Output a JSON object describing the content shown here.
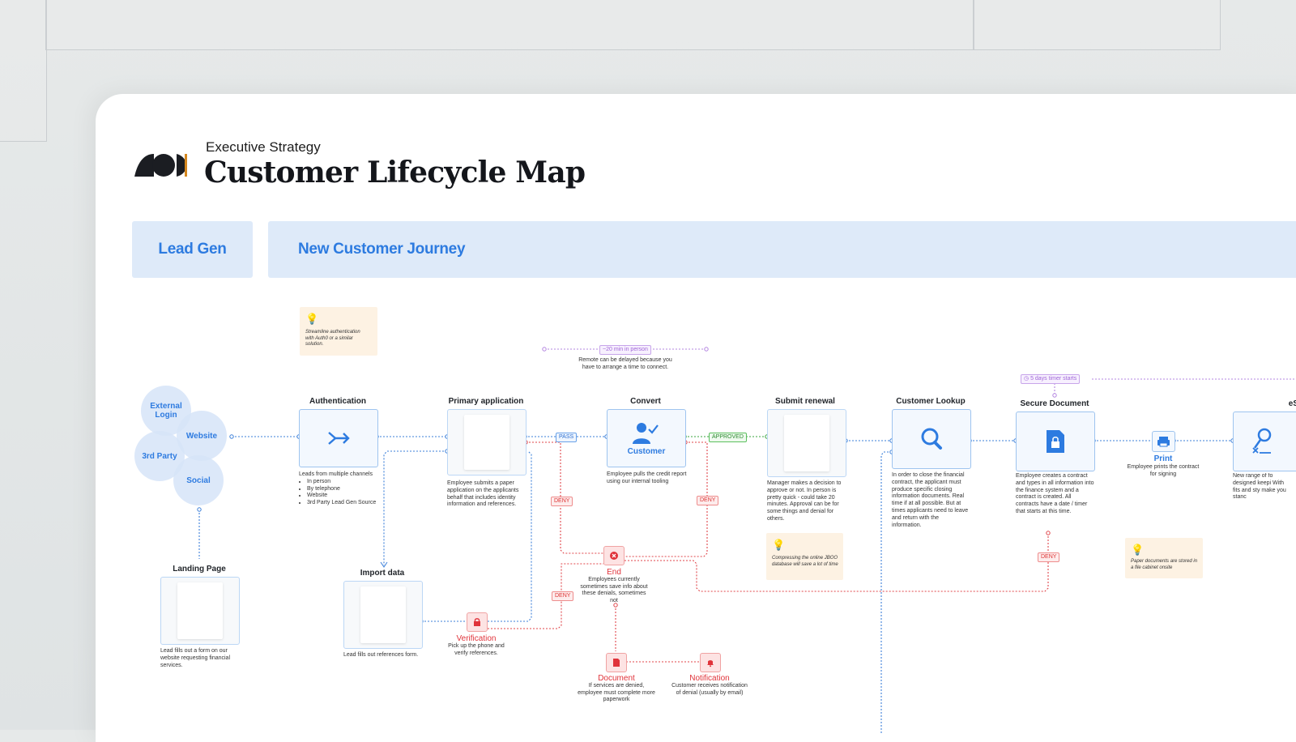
{
  "header": {
    "subtitle": "Executive Strategy",
    "title": "Customer Lifecycle Map"
  },
  "phases": {
    "lead_gen": "Lead Gen",
    "new_customer_journey": "New Customer Journey"
  },
  "sources": {
    "external_login": "External\nLogin",
    "website": "Website",
    "third_party": "3rd Party",
    "social": "Social"
  },
  "notes": {
    "auth_tip": "Streamline authentication with Auth0 or a similar solution.",
    "remote_tag": "~20 min in person",
    "remote_text": "Remote can be delayed because you have to arrange a time to connect.",
    "jboo_tip": "Compressing the online JBOO database will save a lot of time",
    "timer_tag": "5 days timer starts",
    "paper_tip": "Paper documents are stored in a file cabinet onsite"
  },
  "nodes": {
    "authentication": {
      "title": "Authentication",
      "desc": "Leads from multiple channels",
      "bullets": [
        "In person",
        "By telephone",
        "Website",
        "3rd Party Lead Gen Source"
      ]
    },
    "primary_application": {
      "title": "Primary application",
      "desc": "Employee submits a paper application on the applicants behalf that includes identity information and references."
    },
    "convert": {
      "title": "Convert",
      "label": "Customer",
      "desc": "Employee pulls the credit report using our internal tooling"
    },
    "submit_renewal": {
      "title": "Submit renewal",
      "desc": "Manager makes a decision to approve or not. In person is pretty quick - could take 20 minutes. Approval can be for some things and denial for others."
    },
    "customer_lookup": {
      "title": "Customer Lookup",
      "desc": "In order to close the financial contract, the applicant must produce specific closing information documents. Real time if at all possible. But at times applicants need to leave and return with the information."
    },
    "secure_document": {
      "title": "Secure Document",
      "desc": "Employee creates a contract and types in all information into the finance system and a contract is created. All contracts have a date / timer that starts at this time."
    },
    "print": {
      "title": "Print",
      "desc": "Employee prints the contract for signing"
    },
    "esign": {
      "title": "eS",
      "desc": "New range of fo designed keepi With fits and sty make you stanc"
    },
    "landing_page": {
      "title": "Landing Page",
      "desc": "Lead fills out a form on our website requesting financial services."
    },
    "import_data": {
      "title": "Import data",
      "desc": "Lead fills out references form."
    },
    "verification": {
      "title": "Verification",
      "desc": "Pick up the phone and verify references."
    },
    "end": {
      "title": "End",
      "desc": "Employees currently sometimes save info about these denials, sometimes not"
    },
    "document": {
      "title": "Document",
      "desc": "If services are denied, employee must complete more paperwork"
    },
    "notification": {
      "title": "Notification",
      "desc": "Customer receives notification of denial (usually by email)"
    }
  },
  "tags": {
    "pass": "PASS",
    "approved": "APPROVED",
    "deny": "DENY"
  },
  "colors": {
    "accent_blue": "#2d7be0",
    "phase_bg": "#deeaf9",
    "deny_red": "#e0333a",
    "approved_green": "#2b8a2e",
    "timer_purple": "#a066d8",
    "note_bg": "#fdf2e3"
  }
}
